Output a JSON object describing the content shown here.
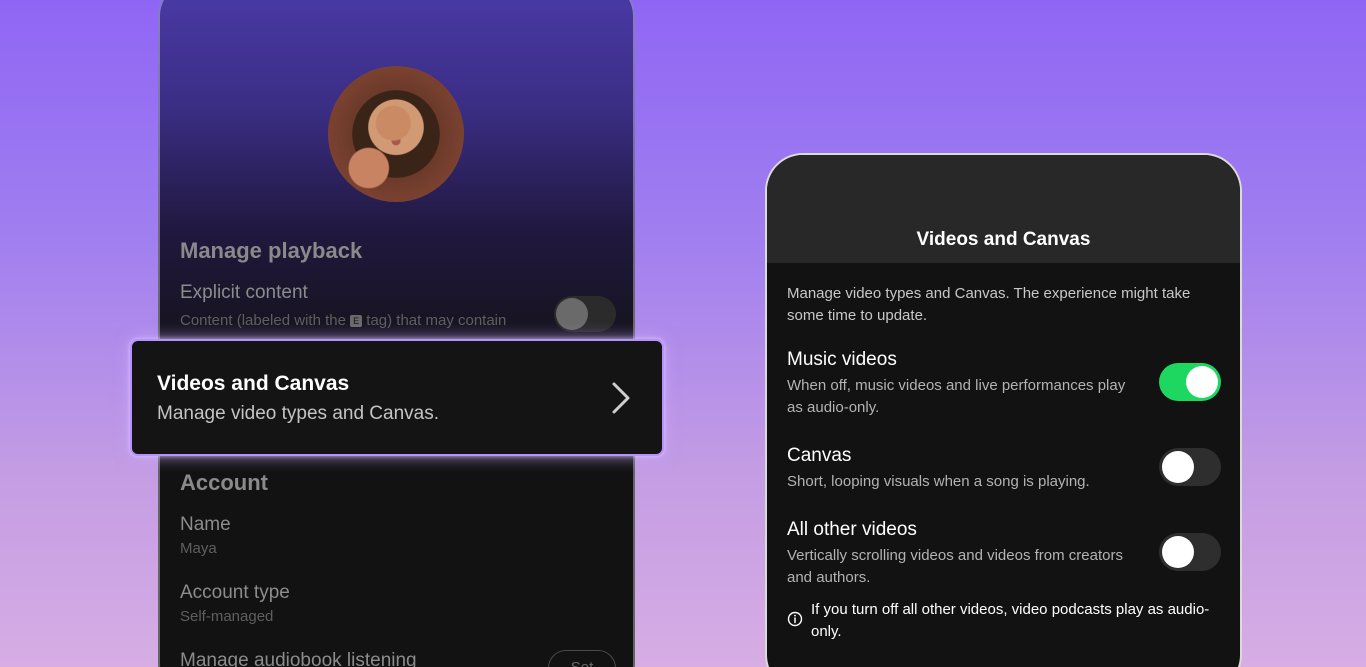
{
  "left_screen": {
    "manage_playback_heading": "Manage playback",
    "explicit": {
      "title": "Explicit content",
      "desc_before": "Content (labeled with the ",
      "tag": "E",
      "desc_after": " tag) that may contain",
      "toggle_on": false
    },
    "account_heading": "Account",
    "name_label": "Name",
    "name_value": "Maya",
    "account_type_label": "Account type",
    "account_type_value": "Self-managed",
    "audiobook_label": "Manage audiobook listening",
    "audiobook_button": "Set"
  },
  "highlight_card": {
    "title": "Videos and Canvas",
    "subtitle": "Manage video types and Canvas."
  },
  "right_screen": {
    "title": "Videos and Canvas",
    "intro": "Manage video types and Canvas. The experience might take some time to update.",
    "options": [
      {
        "title": "Music videos",
        "desc": "When off, music videos and live performances play as audio-only.",
        "enabled": true
      },
      {
        "title": "Canvas",
        "desc": "Short, looping visuals when a song is playing.",
        "enabled": false
      },
      {
        "title": "All other videos",
        "desc": "Vertically scrolling videos and videos from creators and authors.",
        "enabled": false
      }
    ],
    "info_note": "If you turn off all other videos, video podcasts play as audio-only."
  },
  "colors": {
    "toggle_on": "#1ed760",
    "highlight_border": "#b691ff"
  },
  "icons": {
    "chevron": "chevron-right-icon",
    "info": "info-icon"
  }
}
